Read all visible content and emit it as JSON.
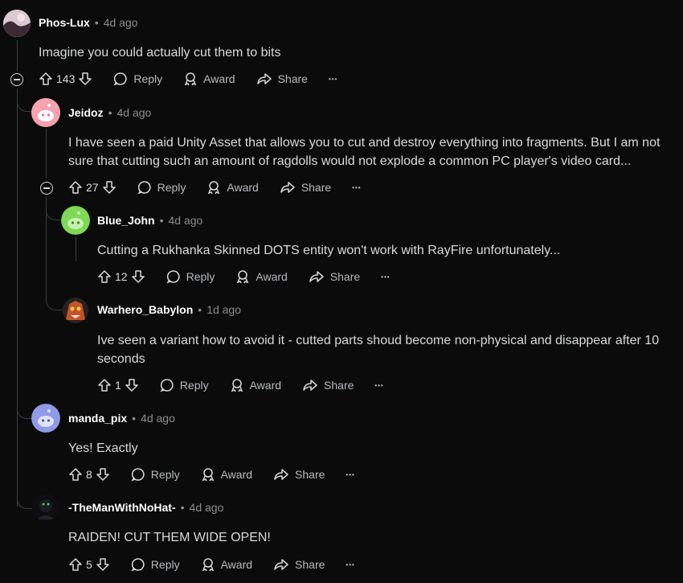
{
  "comments": [
    {
      "username": "Phos-Lux",
      "sep": "•",
      "time": "4d ago",
      "text": "Imagine you could actually cut them to bits",
      "votes": "143",
      "reply": "Reply",
      "award": "Award",
      "share": "Share",
      "more": "•••"
    },
    {
      "username": "Jeidoz",
      "sep": "•",
      "time": "4d ago",
      "text_line1": "I have seen a paid Unity Asset that allows you to cut and destroy everything into fragments. But I am not",
      "text_line2": "sure that cutting such an amount of ragdolls would not explode a common PC player's video card...",
      "votes": "27",
      "reply": "Reply",
      "award": "Award",
      "share": "Share",
      "more": "•••"
    },
    {
      "username": "Blue_John",
      "sep": "•",
      "time": "4d ago",
      "text": "Cutting a Rukhanka Skinned DOTS entity won't work with RayFire unfortunately...",
      "votes": "12",
      "reply": "Reply",
      "award": "Award",
      "share": "Share",
      "more": "•••"
    },
    {
      "username": "Warhero_Babylon",
      "sep": "•",
      "time": "1d ago",
      "text_line1": "Ive seen a variant how to avoid it - cutted parts shoud become non-physical and disappear after 10",
      "text_line2": "seconds",
      "votes": "1",
      "reply": "Reply",
      "award": "Award",
      "share": "Share",
      "more": "•••"
    },
    {
      "username": "manda_pix",
      "sep": "•",
      "time": "4d ago",
      "text": "Yes! Exactly",
      "votes": "8",
      "reply": "Reply",
      "award": "Award",
      "share": "Share",
      "more": "•••"
    },
    {
      "username": "-TheManWithNoHat-",
      "sep": "•",
      "time": "4d ago",
      "text": "RAIDEN! CUT THEM WIDE OPEN!",
      "votes": "5",
      "reply": "Reply",
      "award": "Award",
      "share": "Share",
      "more": "•••"
    }
  ],
  "icons": {
    "upvote": "upvote-arrow-icon",
    "downvote": "downvote-arrow-icon",
    "reply": "speech-bubble-icon",
    "award": "award-ribbon-icon",
    "share": "share-arrow-icon",
    "collapse": "collapse-minus-icon"
  },
  "colors": {
    "background": "#0b0b0b",
    "text": "#d7dadc",
    "muted": "#8a8d91",
    "thread_line": "#3a3d40"
  }
}
